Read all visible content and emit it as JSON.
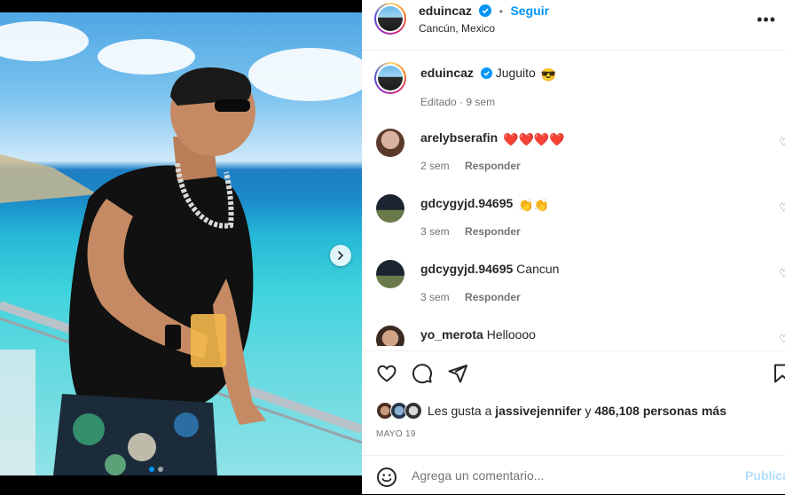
{
  "post": {
    "author": "eduincaz",
    "follow_label": "Seguir",
    "separator": "•",
    "location": "Cancún, Mexico"
  },
  "caption": {
    "author": "eduincaz",
    "text": "Juguito",
    "emoji": "😎",
    "edited_label": "Editado",
    "time": "9 sem"
  },
  "comments": [
    {
      "user": "arelybserafin",
      "text": "",
      "emoji": "❤️❤️❤️❤️",
      "time": "2 sem",
      "reply": "Responder"
    },
    {
      "user": "gdcygyjd.94695",
      "text": "",
      "emoji": "👏👏",
      "time": "3 sem",
      "reply": "Responder"
    },
    {
      "user": "gdcygyjd.94695",
      "text": "Cancun",
      "emoji": "",
      "time": "3 sem",
      "reply": "Responder"
    },
    {
      "user": "yo_merota",
      "text": "Helloooo",
      "emoji": "",
      "time": "",
      "reply": ""
    }
  ],
  "likes": {
    "prefix": "Les gusta a",
    "user": "jassivejennifer",
    "conjunction": "y",
    "count_text": "486,108 personas más"
  },
  "date": "MAYO 19",
  "composer": {
    "placeholder": "Agrega un comentario...",
    "publish_label": "Publica"
  },
  "icons": {
    "verified": "verified-badge-icon",
    "more": "more-options-icon",
    "like": "heart-icon",
    "comment": "comment-icon",
    "share": "send-icon",
    "save": "bookmark-icon",
    "emoji": "smiley-icon",
    "next": "chevron-right-icon"
  },
  "colors": {
    "accent": "#0095f6",
    "text": "#262626",
    "muted": "#737373",
    "publish_disabled": "#b2dffc"
  }
}
